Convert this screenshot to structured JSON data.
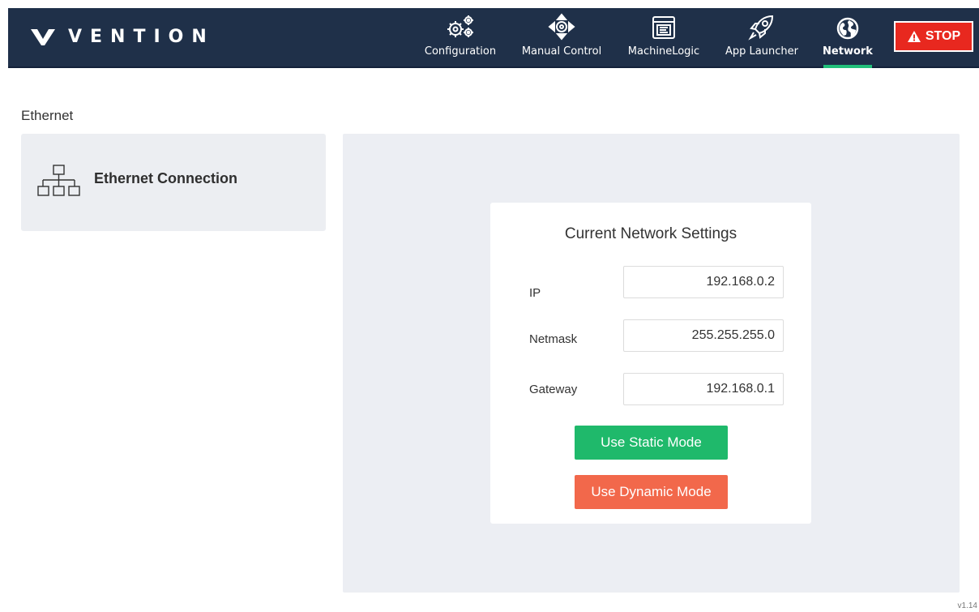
{
  "brand": {
    "name": "VENTION"
  },
  "nav": {
    "items": [
      {
        "label": "Configuration",
        "icon": "gears-icon",
        "active": false
      },
      {
        "label": "Manual Control",
        "icon": "move-arrows-icon",
        "active": false
      },
      {
        "label": "MachineLogic",
        "icon": "logic-panel-icon",
        "active": false
      },
      {
        "label": "App Launcher",
        "icon": "rocket-icon",
        "active": false
      },
      {
        "label": "Network",
        "icon": "globe-icon",
        "active": true
      }
    ],
    "stop_label": "STOP"
  },
  "page": {
    "section_title": "Ethernet",
    "sidebar": {
      "item_label": "Ethernet Connection",
      "icon": "network-topology-icon"
    }
  },
  "settings": {
    "title": "Current Network Settings",
    "ip_label": "IP",
    "ip_value": "192.168.0.2",
    "netmask_label": "Netmask",
    "netmask_value": "255.255.255.0",
    "gateway_label": "Gateway",
    "gateway_value": "192.168.0.1",
    "static_button": "Use Static Mode",
    "dynamic_button": "Use Dynamic Mode"
  },
  "version": "v1.14",
  "colors": {
    "header_bg": "#1f3049",
    "active_underline": "#22c07a",
    "stop": "#e8281f",
    "static_button": "#1fb96b",
    "dynamic_button": "#f2684b",
    "panel_bg": "#eceef3"
  }
}
